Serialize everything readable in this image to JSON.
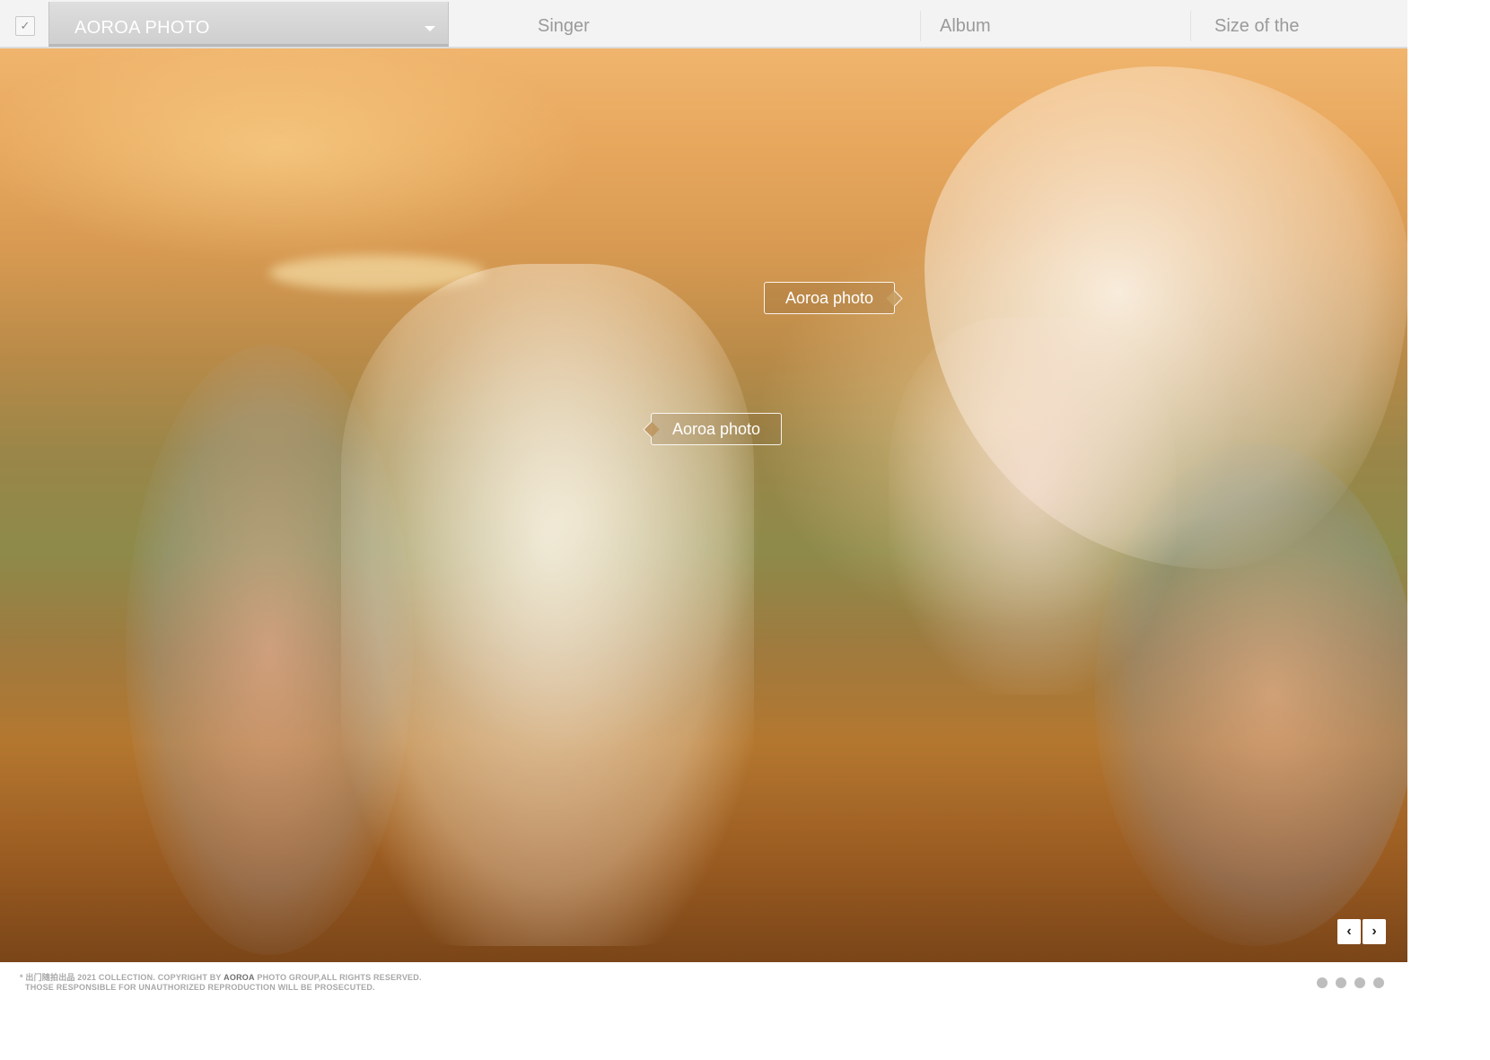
{
  "header": {
    "checkbox_glyph": "✓",
    "select_label": "AOROA PHOTO",
    "columns": [
      "Singer",
      "Album",
      "Size of the"
    ]
  },
  "photo": {
    "tags": [
      "Aoroa photo",
      "Aoroa photo"
    ],
    "nav": {
      "prev_glyph": "‹",
      "next_glyph": "›"
    }
  },
  "footer": {
    "line1_prefix": "* 出门随拍出品 2021 COLLECTION. COPYRIGHT BY ",
    "line1_brand": "AOROA",
    "line1_suffix": " PHOTO GROUP,ALL RIGHTS RESERVED.",
    "line2": "THOSE RESPONSIBLE FOR UNAUTHORIZED REPRODUCTION WILL BE PROSECUTED."
  },
  "pagination": {
    "count": 4
  }
}
